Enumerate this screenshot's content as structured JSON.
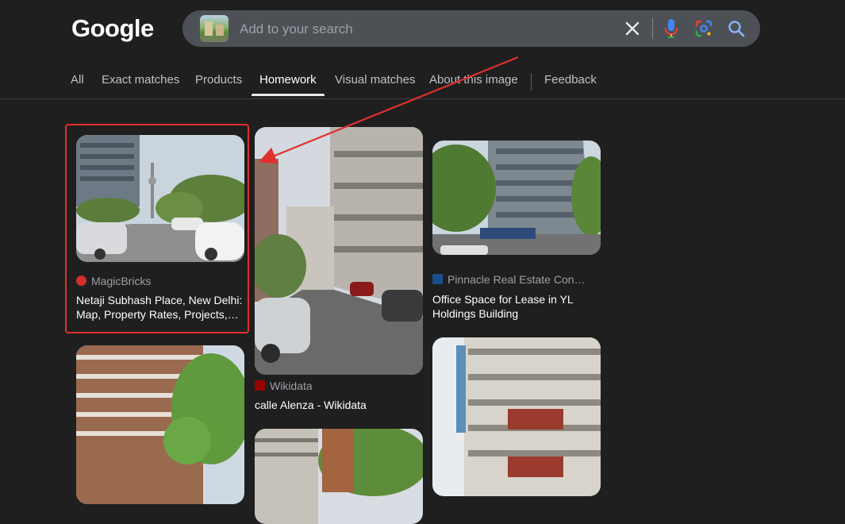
{
  "brand": {
    "logo_text": "Google"
  },
  "search": {
    "placeholder": "Add to your search",
    "value": ""
  },
  "icons": {
    "clear": "close-icon",
    "mic": "microphone-icon",
    "lens": "google-lens-icon",
    "search": "search-icon"
  },
  "tabs": [
    {
      "label": "All",
      "active": false
    },
    {
      "label": "Exact matches",
      "active": false
    },
    {
      "label": "Products",
      "active": false
    },
    {
      "label": "Homework",
      "active": true
    },
    {
      "label": "Visual matches",
      "active": false
    },
    {
      "label": "About this image",
      "active": false
    },
    {
      "label": "Feedback",
      "active": false
    }
  ],
  "results": [
    {
      "source": "MagicBricks",
      "favicon_color": "#d32f2f",
      "title": "Netaji Subhash Place, New Delhi: Map, Property Rates, Projects, Photos, Reviews"
    },
    {
      "source": "Wikidata",
      "favicon_color": "#990000",
      "title": "calle Alenza - Wikidata"
    },
    {
      "source": "Pinnacle Real Estate Con…",
      "favicon_color": "#1a4f8b",
      "title": "Office Space for Lease in YL Holdings Building"
    },
    {
      "source": "",
      "title": ""
    },
    {
      "source": "",
      "title": ""
    },
    {
      "source": "",
      "title": ""
    }
  ],
  "colors": {
    "background": "#1f1f1f",
    "searchbox": "#4d5156",
    "annotation": "#e0302e",
    "active_tab": "#ffffff"
  }
}
